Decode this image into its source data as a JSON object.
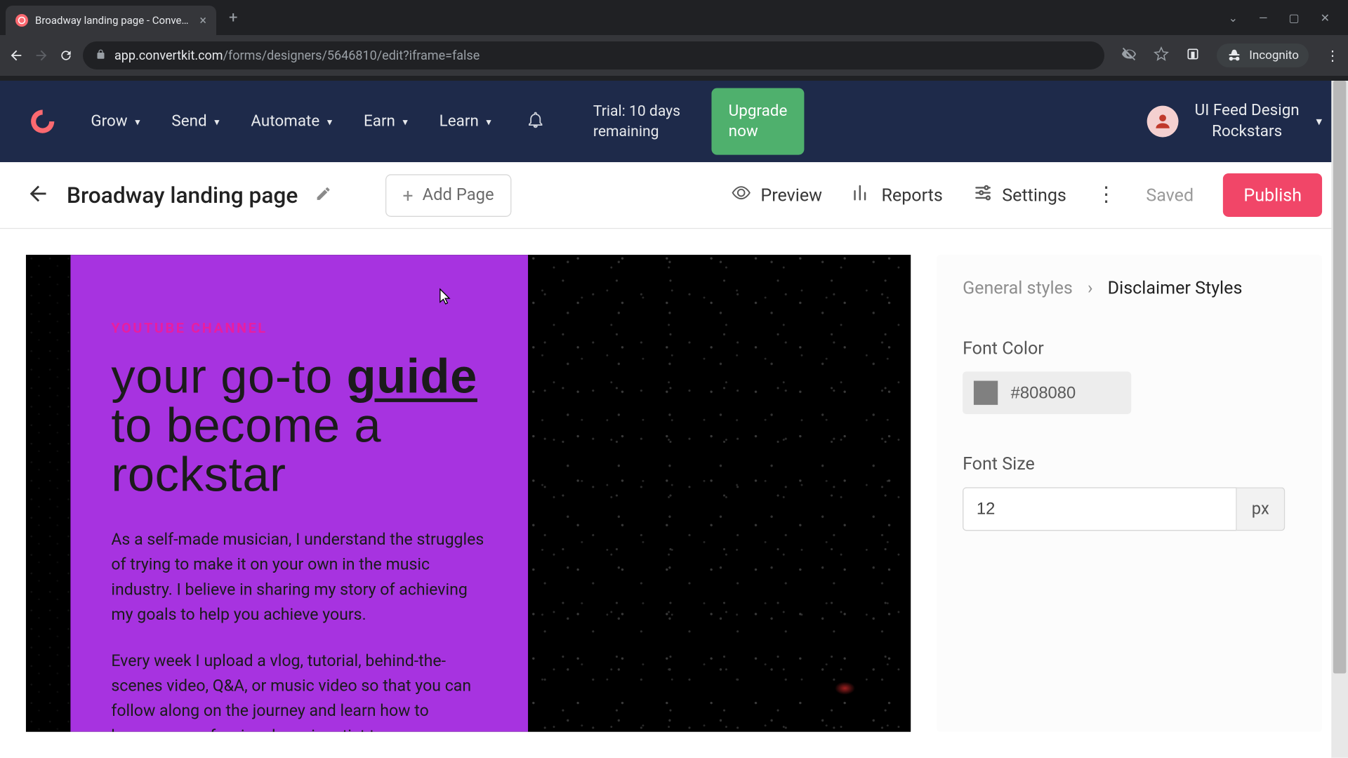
{
  "browser": {
    "tab_title": "Broadway landing page - Conve…",
    "url_host": "app.convertkit.com",
    "url_path": "/forms/designers/5646810/edit?iframe=false",
    "incognito_label": "Incognito"
  },
  "topnav": {
    "items": [
      "Grow",
      "Send",
      "Automate",
      "Earn",
      "Learn"
    ],
    "trial_line1": "Trial: 10 days",
    "trial_line2": "remaining",
    "upgrade_line1": "Upgrade",
    "upgrade_line2": "now",
    "team_line1": "UI Feed Design",
    "team_line2": "Rockstars"
  },
  "pagebar": {
    "title": "Broadway landing page",
    "add_page": "Add Page",
    "preview": "Preview",
    "reports": "Reports",
    "settings": "Settings",
    "saved": "Saved",
    "publish": "Publish"
  },
  "canvas": {
    "eyebrow": "YOUTUBE CHANNEL",
    "hero_pre": "your go-to ",
    "hero_guide": "guide",
    "hero_post": " to become a rockstar",
    "para1": "As a self-made musician, I understand the struggles of trying to make it on your own in the music industry. I believe in sharing my story of achieving my goals to help you achieve yours.",
    "para2": "Every week I upload a vlog, tutorial, behind-the-scenes video, Q&A, or music video so that you can follow along on the journey and learn how to become a professional music artist too."
  },
  "sidepanel": {
    "bc_root": "General styles",
    "bc_leaf": "Disclaimer Styles",
    "font_color_label": "Font Color",
    "font_color_value": "#808080",
    "font_size_label": "Font Size",
    "font_size_value": "12",
    "font_size_unit": "px"
  }
}
